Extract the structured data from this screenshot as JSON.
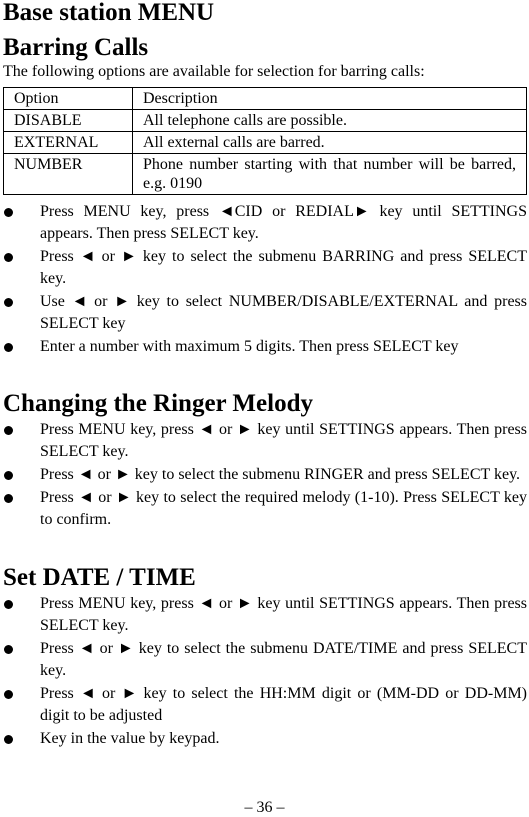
{
  "page_title": "Base station MENU",
  "sections": {
    "barring": {
      "heading": "Barring Calls",
      "intro": "The following options are available for selection for barring calls:",
      "table": {
        "headers": [
          "Option",
          "Description"
        ],
        "rows": [
          [
            "DISABLE",
            "All telephone calls are possible."
          ],
          [
            "EXTERNAL",
            "All external calls are barred."
          ],
          [
            "NUMBER",
            "Phone number starting with that number will be barred, e.g. 0190"
          ]
        ]
      },
      "steps": [
        "Press MENU key, press ◄CID or REDIAL► key until SETTINGS appears. Then press SELECT key.",
        "Press ◄ or ► key to select the submenu BARRING and press SELECT key.",
        "Use ◄ or ► key to select NUMBER/DISABLE/EXTERNAL and press SELECT key",
        "Enter a number with maximum 5 digits. Then press SELECT key"
      ]
    },
    "ringer": {
      "heading": "Changing the Ringer Melody",
      "steps": [
        "Press MENU key, press ◄ or ► key until SETTINGS appears. Then press SELECT key.",
        "Press ◄ or ► key to select the submenu RINGER and press SELECT key.",
        "Press ◄ or ► key to select the required melody (1-10). Press SELECT key to confirm."
      ]
    },
    "datetime": {
      "heading": "Set DATE / TIME",
      "steps": [
        "Press MENU key, press ◄ or ► key until SETTINGS appears. Then press SELECT key.",
        "Press ◄ or ► key to select the submenu DATE/TIME and press SELECT key.",
        "Press ◄ or ► key to select the HH:MM digit or (MM-DD or DD-MM) digit to be adjusted",
        "Key in the value by keypad."
      ]
    }
  },
  "footer": {
    "page_number": "– 36 –"
  }
}
